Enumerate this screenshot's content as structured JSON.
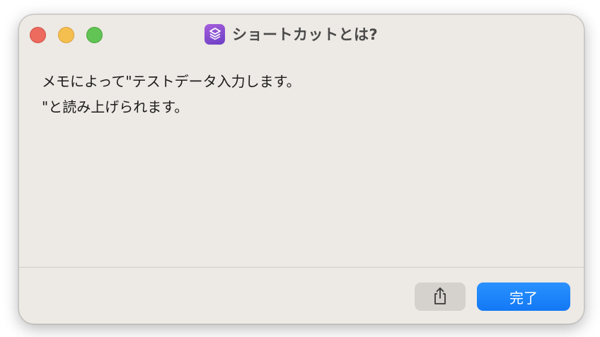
{
  "window": {
    "title": "ショートカットとは?",
    "app_icon": "shortcuts-icon",
    "accent_color": "#1a82fb"
  },
  "message": {
    "line1": "メモによって\"テストデータ入力します。",
    "line2": "\"と読み上げられます。"
  },
  "footer": {
    "share_icon": "share-icon",
    "done_label": "完了"
  }
}
